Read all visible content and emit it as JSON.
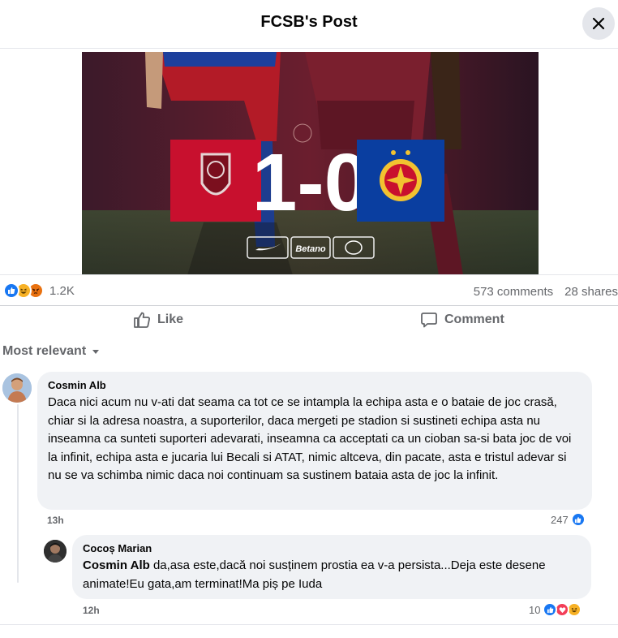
{
  "header": {
    "title": "FCSB's Post"
  },
  "post_image": {
    "score": "1-0",
    "sponsors": [
      "Betano"
    ],
    "colors": {
      "cfr_red": "#c8102e",
      "fcsb_blue": "#0a3ea0",
      "maroon": "#6b1e2e"
    }
  },
  "reactions": {
    "icons": [
      "like-icon",
      "haha-icon",
      "angry-icon"
    ],
    "count": "1.2K"
  },
  "stats": {
    "comments": "573 comments",
    "shares": "28 shares"
  },
  "actions": {
    "like": "Like",
    "comment": "Comment"
  },
  "sort": {
    "label": "Most relevant"
  },
  "comments": [
    {
      "author": "Cosmin Alb",
      "text": "Daca nici acum nu v-ati dat seama ca tot ce se intampla la echipa asta e o bataie de joc crasă, chiar si la adresa noastra, a suporterilor, daca mergeti pe stadion si sustineti echipa asta nu inseamna ca sunteti suporteri adevarati, inseamna ca acceptati ca un cioban sa-si bata joc de voi la infinit, echipa asta e jucaria lui Becali si ATAT, nimic altceva, din pacate, asta e tristul adevar si nu se va schimba nimic daca noi continuam sa sustinem bataia asta de joc la infinit.",
      "time": "13h",
      "reaction_count": "247"
    },
    {
      "author": "Cocoș Marian",
      "mention": "Cosmin Alb",
      "text": " da,asa este,dacă noi susținem prostia ea v-a persista...Deja este desene animate!Eu gata,am terminat!Ma piș pe Iuda",
      "time": "12h",
      "reaction_count": "10"
    }
  ],
  "colors": {
    "facebook_blue": "#1877f2",
    "secondary_text": "#65676b",
    "bubble_bg": "#f0f2f5"
  }
}
